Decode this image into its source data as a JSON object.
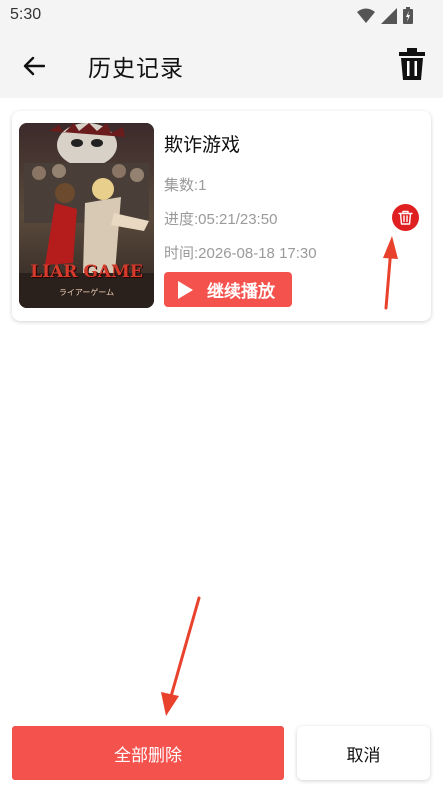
{
  "status_bar": {
    "time": "5:30",
    "icons": [
      "wifi-icon",
      "signal-icon",
      "battery-icon"
    ]
  },
  "app_bar": {
    "title": "历史记录",
    "back_icon": "arrow-left-icon",
    "action_icon": "trash-icon"
  },
  "history": {
    "items": [
      {
        "title": "欺诈游戏",
        "poster_caption": "LIAR GAME",
        "poster_subcaption": "ライアーゲーム",
        "episode": "集数:1",
        "progress": "进度:05:21/23:50",
        "time": "时间:2026-08-18 17:30",
        "resume_label": "继续播放",
        "delete_icon": "trash-icon"
      }
    ]
  },
  "footer": {
    "delete_all_label": "全部删除",
    "cancel_label": "取消"
  },
  "colors": {
    "accent": "#f4524d",
    "delete_red": "#e02020",
    "annotation_arrow": "#e8412c",
    "app_bar_bg": "#f4f4f4"
  }
}
